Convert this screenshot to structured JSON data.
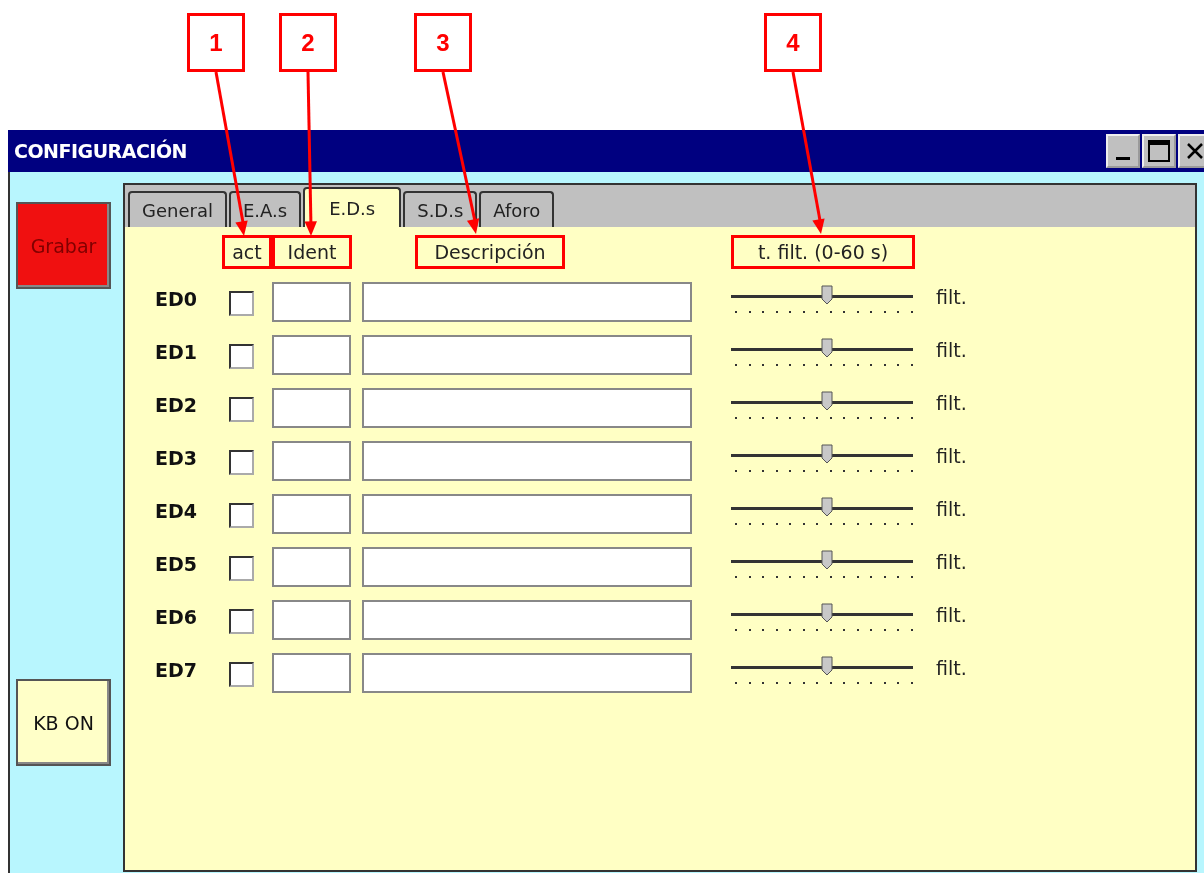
{
  "window": {
    "title": "CONFIGURACIÓN"
  },
  "side_buttons": [
    {
      "label": "Grabar",
      "kind": "save"
    },
    {
      "label": "KB ON",
      "kind": "keyboard"
    }
  ],
  "tabs": [
    {
      "label": "General",
      "selected": false
    },
    {
      "label": "E.A.s",
      "selected": false
    },
    {
      "label": "E.D.s",
      "selected": true
    },
    {
      "label": "S.D.s",
      "selected": false
    },
    {
      "label": "Aforo",
      "selected": false
    }
  ],
  "columns": [
    {
      "label": "act",
      "highlighted": true
    },
    {
      "label": "Ident",
      "highlighted": true
    },
    {
      "label": "Descripción",
      "highlighted": true
    },
    {
      "label": "t. filt. (0-60 s)",
      "highlighted": true
    }
  ],
  "rows": [
    {
      "label": "ED0",
      "checked": false,
      "level": 0.53,
      "reading": "filt."
    },
    {
      "label": "ED1",
      "checked": false,
      "level": 0.53,
      "reading": "filt."
    },
    {
      "label": "ED2",
      "checked": false,
      "level": 0.53,
      "reading": "filt."
    },
    {
      "label": "ED3",
      "checked": false,
      "level": 0.53,
      "reading": "filt."
    },
    {
      "label": "ED4",
      "checked": false,
      "level": 0.53,
      "reading": "filt."
    },
    {
      "label": "ED5",
      "checked": false,
      "level": 0.53,
      "reading": "filt."
    },
    {
      "label": "ED6",
      "checked": false,
      "level": 0.53,
      "reading": "filt."
    },
    {
      "label": "ED7",
      "checked": false,
      "level": 0.53,
      "reading": "filt."
    }
  ],
  "callouts": [
    {
      "number": "1"
    },
    {
      "number": "2"
    },
    {
      "number": "3"
    },
    {
      "number": "4"
    }
  ]
}
